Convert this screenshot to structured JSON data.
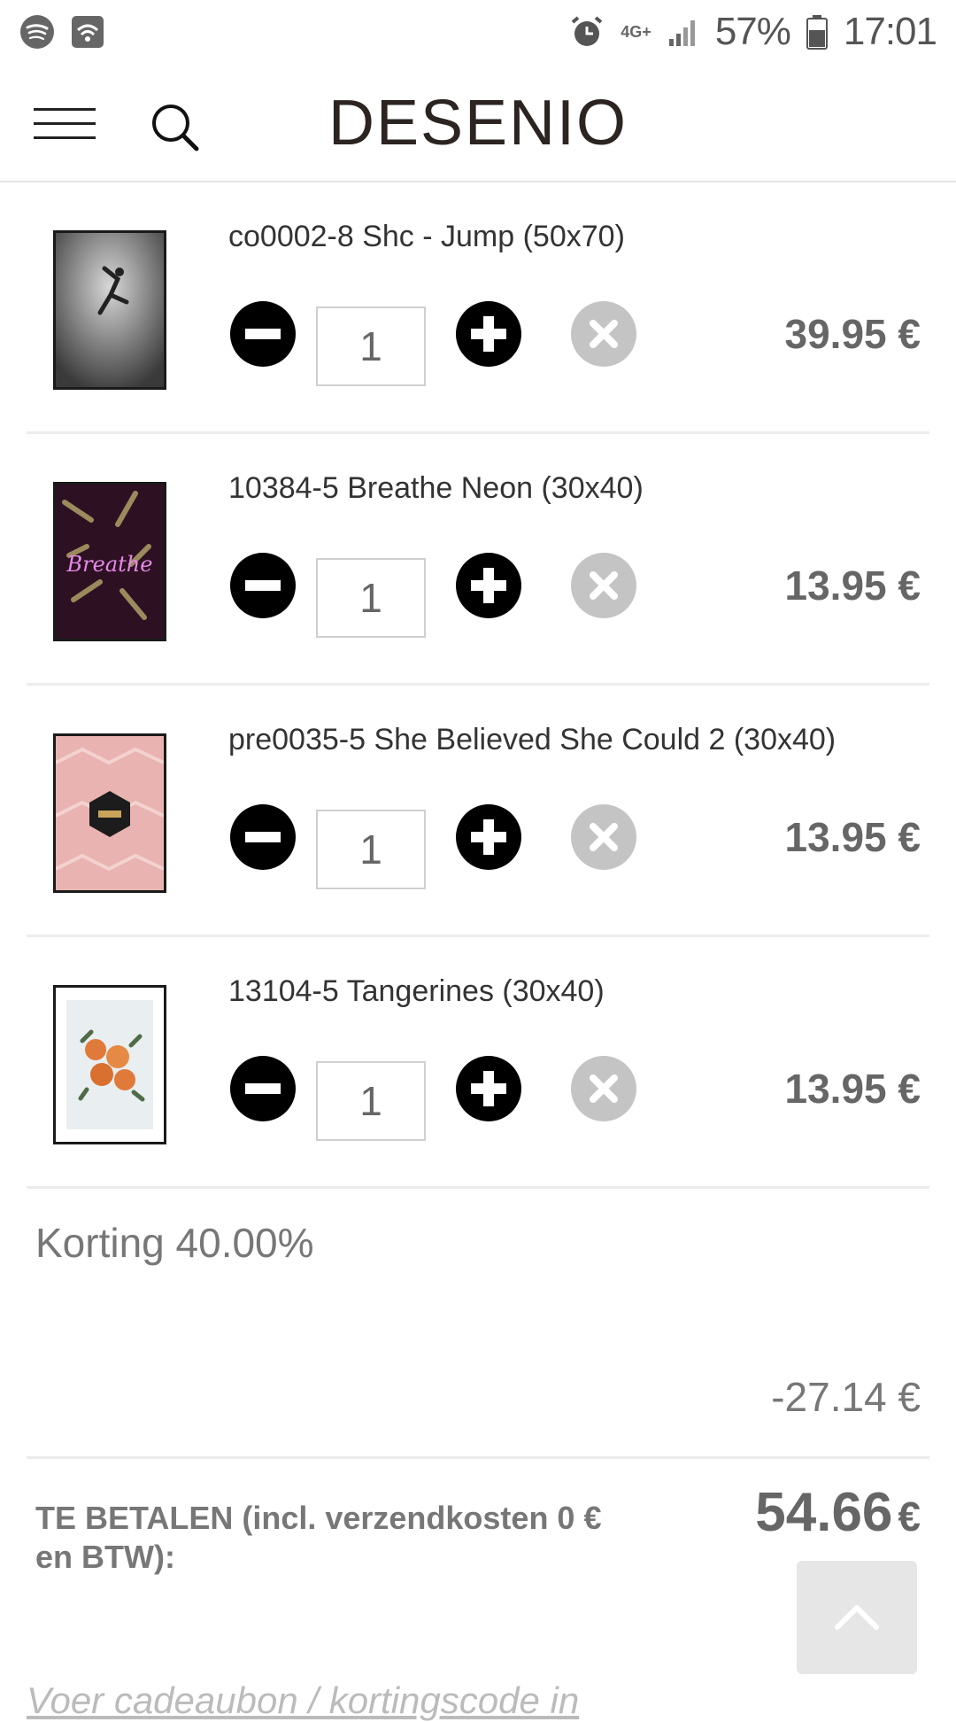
{
  "status_bar": {
    "icons_left": [
      "spotify-icon",
      "wifi-hotspot-icon"
    ],
    "network": "4G+",
    "battery": "57%",
    "time": "17:01"
  },
  "header": {
    "logo": "DESENIO"
  },
  "cart": {
    "items": [
      {
        "name": "co0002-8 Shc - Jump (50x70)",
        "quantity": "1",
        "price": "39.95 €"
      },
      {
        "name": "10384-5 Breathe Neon (30x40)",
        "quantity": "1",
        "price": "13.95 €"
      },
      {
        "name": "pre0035-5 She Believed She Could 2 (30x40)",
        "quantity": "1",
        "price": "13.95 €"
      },
      {
        "name": "13104-5 Tangerines (30x40)",
        "quantity": "1",
        "price": "13.95 €"
      }
    ],
    "discount_label": "Korting 40.00%",
    "discount_value": "-27.14 €",
    "total_label": "TE BETALEN (incl. verzendkosten 0 € en BTW):",
    "total_value": "54.66",
    "total_currency": "€",
    "voucher_link": "Voer cadeaubon / kortingscode in"
  },
  "colors": {
    "accent": "#000000",
    "remove": "#c4c4c4",
    "muted_text": "#777777"
  }
}
